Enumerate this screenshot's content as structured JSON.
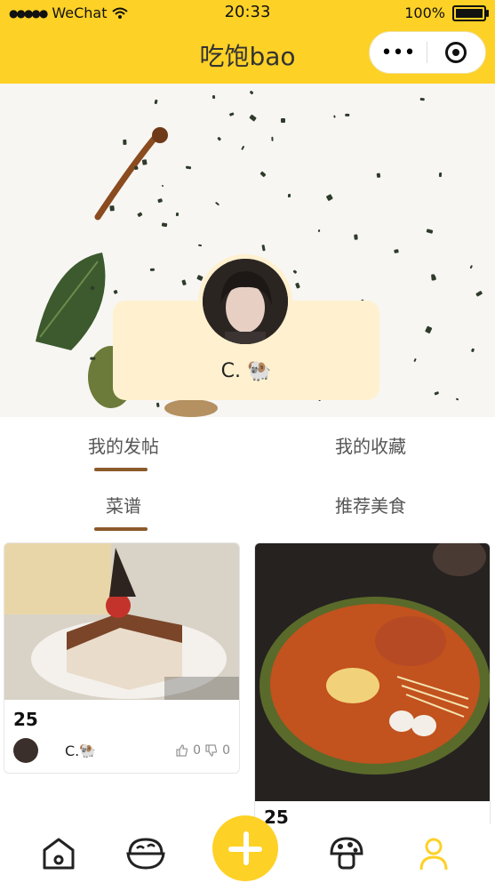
{
  "status_bar": {
    "carrier": "WeChat",
    "time": "20:33",
    "battery": "100%"
  },
  "nav": {
    "title": "吃饱bao",
    "more_glyph": "•••"
  },
  "profile": {
    "name": "C.",
    "emoji": "🐏"
  },
  "tabs_primary": [
    {
      "label": "我的发帖",
      "active": true
    },
    {
      "label": "我的收藏",
      "active": false
    }
  ],
  "tabs_secondary": [
    {
      "label": "菜谱",
      "active": true
    },
    {
      "label": "推荐美食",
      "active": false
    }
  ],
  "posts": [
    {
      "number": "25",
      "author": "C.",
      "author_emoji": "🐏",
      "likes": "0",
      "dislikes": "0"
    },
    {
      "number": "25"
    }
  ],
  "bottom_nav": [
    {
      "icon": "home-icon"
    },
    {
      "icon": "rice-bowl-icon"
    },
    {
      "icon": "plus-icon"
    },
    {
      "icon": "mushroom-icon"
    },
    {
      "icon": "person-icon",
      "active": true
    }
  ],
  "colors": {
    "accent": "#FDD126",
    "tab_underline": "#8B5A2B",
    "card_bg": "#FFF1CF"
  }
}
